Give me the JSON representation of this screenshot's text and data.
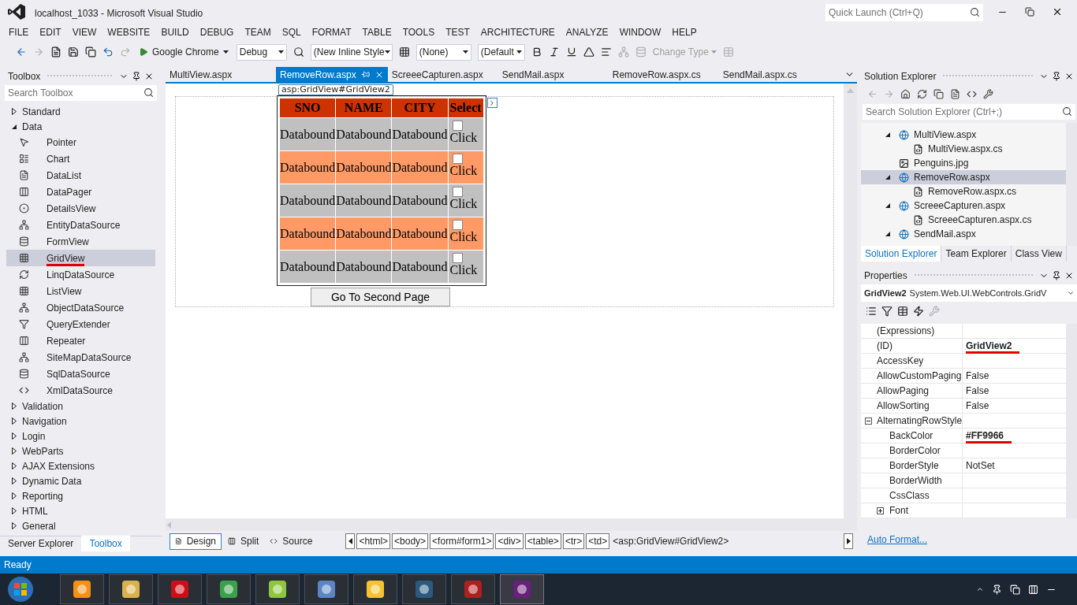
{
  "window": {
    "title": "localhost_1033 - Microsoft Visual Studio",
    "quick_launch_placeholder": "Quick Launch (Ctrl+Q)"
  },
  "menu": [
    "FILE",
    "EDIT",
    "VIEW",
    "WEBSITE",
    "BUILD",
    "DEBUG",
    "TEAM",
    "SQL",
    "FORMAT",
    "TABLE",
    "TOOLS",
    "TEST",
    "ARCHITECTURE",
    "ANALYZE",
    "WINDOW",
    "HELP"
  ],
  "toolbar": {
    "run_target": "Google Chrome",
    "configuration": "Debug",
    "style_target": "(New Inline Style",
    "style_none": "(None)",
    "font": "(Default",
    "change_type": "Change Type"
  },
  "toolbox": {
    "title": "Toolbox",
    "search_placeholder": "Search Toolbox",
    "groups": [
      {
        "label": "Standard",
        "expanded": false
      },
      {
        "label": "Data",
        "expanded": true,
        "items": [
          {
            "label": "Pointer",
            "selected": false,
            "underlined": false
          },
          {
            "label": "Chart",
            "selected": false,
            "underlined": false
          },
          {
            "label": "DataList",
            "selected": false,
            "underlined": false
          },
          {
            "label": "DataPager",
            "selected": false,
            "underlined": false
          },
          {
            "label": "DetailsView",
            "selected": false,
            "underlined": false
          },
          {
            "label": "EntityDataSource",
            "selected": false,
            "underlined": false
          },
          {
            "label": "FormView",
            "selected": false,
            "underlined": false
          },
          {
            "label": "GridView",
            "selected": true,
            "underlined": true
          },
          {
            "label": "LinqDataSource",
            "selected": false,
            "underlined": false
          },
          {
            "label": "ListView",
            "selected": false,
            "underlined": false
          },
          {
            "label": "ObjectDataSource",
            "selected": false,
            "underlined": false
          },
          {
            "label": "QueryExtender",
            "selected": false,
            "underlined": false
          },
          {
            "label": "Repeater",
            "selected": false,
            "underlined": false
          },
          {
            "label": "SiteMapDataSource",
            "selected": false,
            "underlined": false
          },
          {
            "label": "SqlDataSource",
            "selected": false,
            "underlined": false
          },
          {
            "label": "XmlDataSource",
            "selected": false,
            "underlined": false
          }
        ]
      },
      {
        "label": "Validation",
        "expanded": false
      },
      {
        "label": "Navigation",
        "expanded": false
      },
      {
        "label": "Login",
        "expanded": false
      },
      {
        "label": "WebParts",
        "expanded": false
      },
      {
        "label": "AJAX Extensions",
        "expanded": false
      },
      {
        "label": "Dynamic Data",
        "expanded": false
      },
      {
        "label": "Reporting",
        "expanded": false
      },
      {
        "label": "HTML",
        "expanded": false
      },
      {
        "label": "General",
        "expanded": false
      }
    ],
    "bottom_tabs": [
      {
        "label": "Server Explorer",
        "selected": false
      },
      {
        "label": "Toolbox",
        "selected": true
      }
    ]
  },
  "editor_tabs": [
    {
      "label": "MultiView.aspx",
      "selected": false
    },
    {
      "label": "RemoveRow.aspx",
      "selected": true
    },
    {
      "label": "ScreeeCapturen.aspx",
      "selected": false
    },
    {
      "label": "SendMail.aspx",
      "selected": false
    },
    {
      "label": "RemoveRow.aspx.cs",
      "selected": false
    },
    {
      "label": "SendMail.aspx.cs",
      "selected": false
    }
  ],
  "designer": {
    "control_tag": "asp:GridView#GridView2",
    "columns": [
      "SNO",
      "NAME",
      "CITY",
      "Select"
    ],
    "rows": [
      {
        "cells": [
          "Databound",
          "Databound",
          "Databound"
        ],
        "check_label": "Click",
        "checked": false,
        "color": "#c0c0c0"
      },
      {
        "cells": [
          "Databound",
          "Databound",
          "Databound"
        ],
        "check_label": "Click",
        "checked": false,
        "color": "#ff9966"
      },
      {
        "cells": [
          "Databound",
          "Databound",
          "Databound"
        ],
        "check_label": "Click",
        "checked": false,
        "color": "#c0c0c0"
      },
      {
        "cells": [
          "Databound",
          "Databound",
          "Databound"
        ],
        "check_label": "Click",
        "checked": false,
        "color": "#ff9966"
      },
      {
        "cells": [
          "Databound",
          "Databound",
          "Databound"
        ],
        "check_label": "Click",
        "checked": false,
        "color": "#c0c0c0"
      }
    ],
    "button": "Go To Second Page"
  },
  "view_tabs": [
    {
      "label": "Design",
      "selected": true
    },
    {
      "label": "Split",
      "selected": false
    },
    {
      "label": "Source",
      "selected": false
    }
  ],
  "breadcrumbs": [
    {
      "label": "<html>",
      "selected": false
    },
    {
      "label": "<body>",
      "selected": false
    },
    {
      "label": "<form#form1>",
      "selected": false
    },
    {
      "label": "<div>",
      "selected": false
    },
    {
      "label": "<table>",
      "selected": false
    },
    {
      "label": "<tr>",
      "selected": false
    },
    {
      "label": "<td>",
      "selected": false
    },
    {
      "label": "<asp:GridView#GridView2>",
      "selected": true
    }
  ],
  "solution_explorer": {
    "title": "Solution Explorer",
    "search_placeholder": "Search Solution Explorer (Ctrl+;)",
    "items": [
      {
        "label": "MultiView.aspx",
        "kind": "page",
        "expanded": true,
        "selected": false,
        "children": [
          {
            "label": "MultiView.aspx.cs",
            "kind": "code",
            "selected": false
          }
        ]
      },
      {
        "label": "Penguins.jpg",
        "kind": "image",
        "selected": false
      },
      {
        "label": "RemoveRow.aspx",
        "kind": "page",
        "expanded": true,
        "selected": true,
        "children": [
          {
            "label": "RemoveRow.aspx.cs",
            "kind": "code",
            "selected": false
          }
        ]
      },
      {
        "label": "ScreeeCapturen.aspx",
        "kind": "page",
        "expanded": true,
        "selected": false,
        "children": [
          {
            "label": "ScreeeCapturen.aspx.cs",
            "kind": "code",
            "selected": false
          }
        ]
      },
      {
        "label": "SendMail.aspx",
        "kind": "page",
        "expanded": true,
        "selected": false
      }
    ],
    "bottom_tabs": [
      {
        "label": "Solution Explorer",
        "selected": true
      },
      {
        "label": "Team Explorer",
        "selected": false
      },
      {
        "label": "Class View",
        "selected": false
      }
    ]
  },
  "properties": {
    "title": "Properties",
    "object_name": "GridView2",
    "object_type": "System.Web.UI.WebControls.GridV",
    "rows": [
      {
        "name": "(Expressions)"
      },
      {
        "name": "(ID)",
        "value": "GridView2",
        "bold": true,
        "underlined": true
      },
      {
        "name": "AccessKey"
      },
      {
        "name": "AllowCustomPaging",
        "value": "False"
      },
      {
        "name": "AllowPaging",
        "value": "False"
      },
      {
        "name": "AllowSorting",
        "value": "False"
      },
      {
        "name": "AlternatingRowStyle",
        "expanded": true,
        "children": [
          {
            "name": "BackColor",
            "value": "#FF9966",
            "bold": true,
            "underlined": true
          },
          {
            "name": "BorderColor"
          },
          {
            "name": "BorderStyle",
            "value": "NotSet"
          },
          {
            "name": "BorderWidth"
          },
          {
            "name": "CssClass"
          },
          {
            "name": "Font",
            "expanded": false
          }
        ]
      }
    ],
    "link": "Auto Format..."
  },
  "status_bar": {
    "text": "Ready"
  }
}
